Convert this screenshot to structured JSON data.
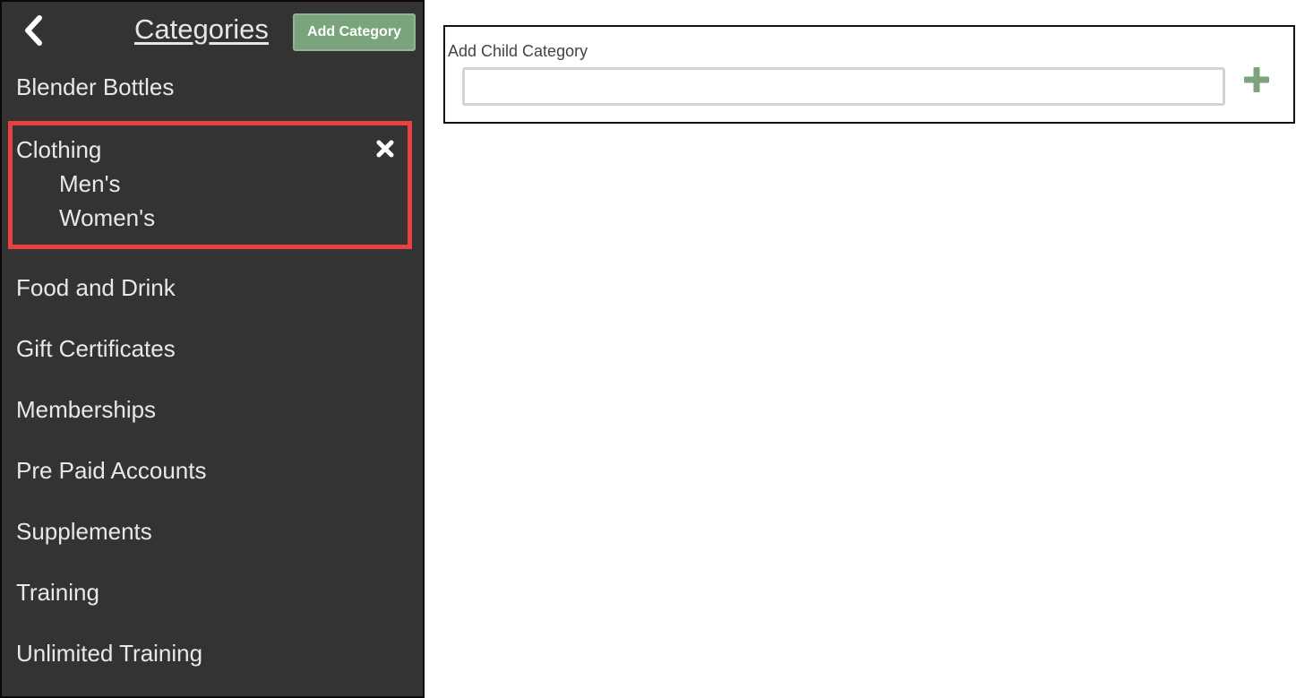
{
  "sidebar": {
    "title": "Categories",
    "add_button_label": "Add Category",
    "categories": [
      {
        "label": "Blender Bottles"
      },
      {
        "label": "Clothing",
        "children": [
          {
            "label": "Men's"
          },
          {
            "label": "Women's"
          }
        ]
      },
      {
        "label": "Food and Drink"
      },
      {
        "label": "Gift Certificates"
      },
      {
        "label": "Memberships"
      },
      {
        "label": "Pre Paid Accounts"
      },
      {
        "label": "Supplements"
      },
      {
        "label": "Training"
      },
      {
        "label": "Unlimited Training"
      }
    ]
  },
  "child_panel": {
    "label": "Add Child Category",
    "input_value": "",
    "input_placeholder": ""
  },
  "colors": {
    "sidebar_bg": "#333333",
    "accent_green": "#7aa57c",
    "highlight_red": "#e8413f"
  },
  "icons": {
    "back": "chevron-left-icon",
    "remove": "close-icon",
    "add": "plus-icon"
  }
}
